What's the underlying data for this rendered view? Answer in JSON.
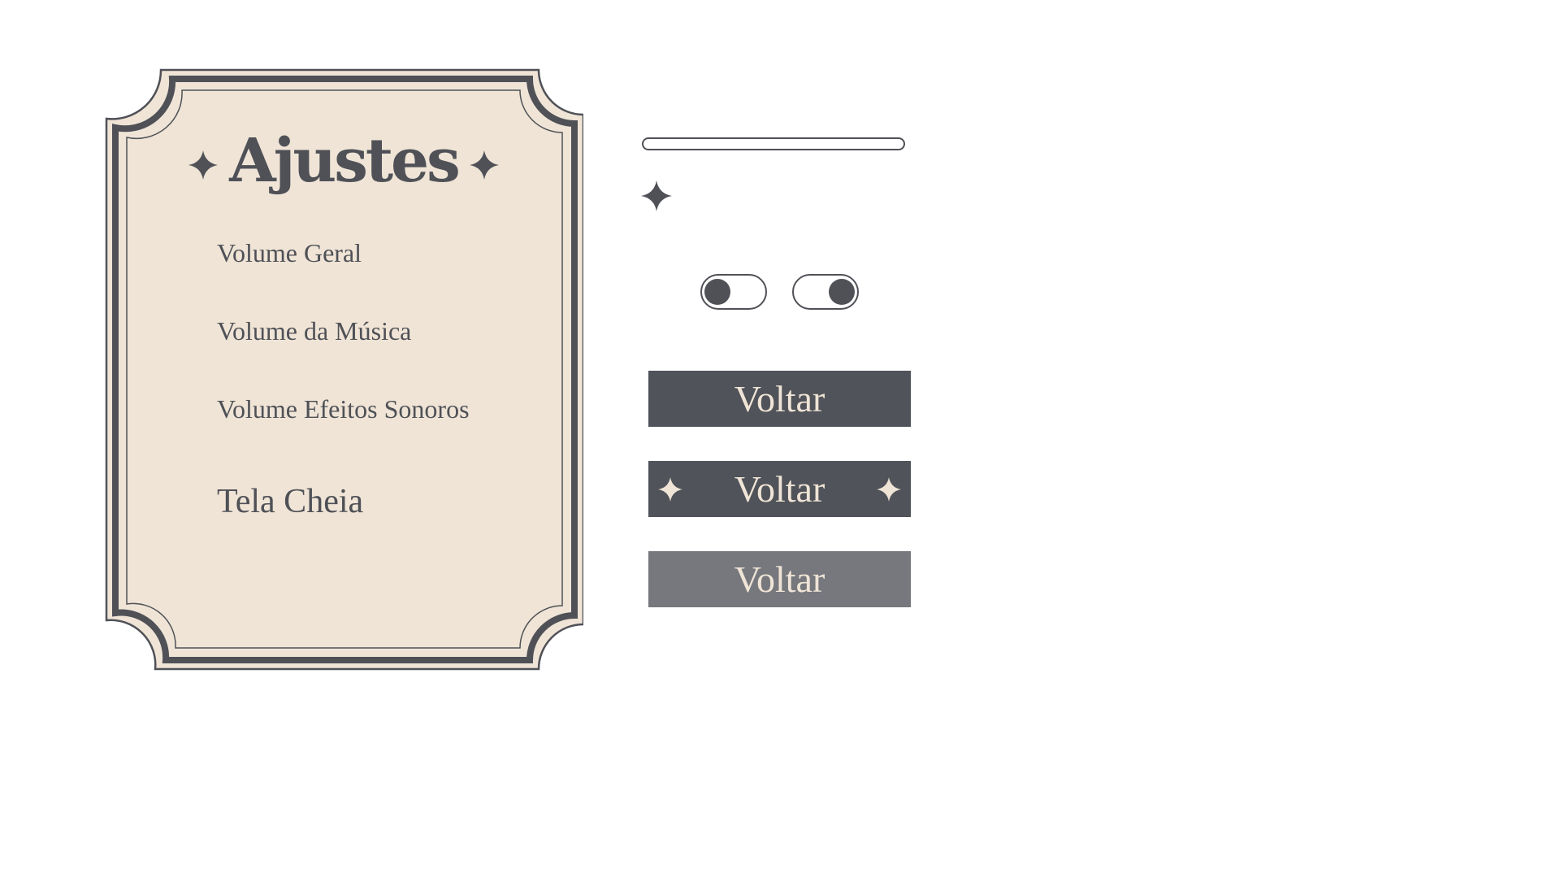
{
  "settings_panel": {
    "title": "Ajustes",
    "labels": {
      "general_volume": "Volume Geral",
      "music_volume": "Volume da Música",
      "sfx_volume": "Volume Efeitos Sonoros",
      "fullscreen": "Tela Cheia"
    }
  },
  "widgets": {
    "toggle_off_state": "off",
    "toggle_on_state": "on",
    "buttons": {
      "normal_label": "Voltar",
      "hover_label": "Voltar",
      "pressed_label": "Voltar"
    }
  },
  "colors": {
    "panel_bg": "#efe4d6",
    "ink": "#4f5157",
    "button_bg": "#505359",
    "button_pressed_bg": "#76787d",
    "button_text": "#efe4d6",
    "page_bg": "#ffffff"
  },
  "icons": {
    "title_ornament": "four-point-star-icon",
    "slider_knob": "four-point-star-icon",
    "button_ornament": "four-point-star-icon"
  }
}
